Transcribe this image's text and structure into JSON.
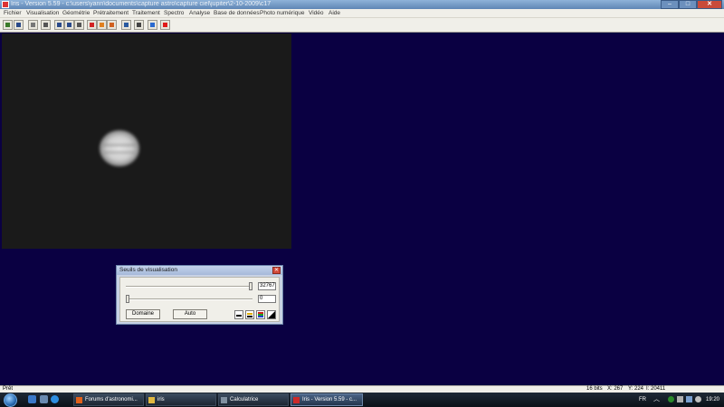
{
  "window": {
    "title": "Iris - Version 5.59 - c:\\users\\yann\\documents\\capture astro\\capture ciel\\jupiter\\2-10-2009\\c17",
    "minimize_glyph": "–",
    "maximize_glyph": "□",
    "close_glyph": "✕"
  },
  "menu": [
    "Fichier",
    "Visualisation",
    "Géométrie",
    "Prétraitement",
    "Traitement",
    "Spectro",
    "Analyse",
    "Base de données",
    "Photo numérique",
    "Vidéo",
    "Aide"
  ],
  "toolbar": {
    "icons": [
      "open-file-icon",
      "save-icon",
      "undo-icon",
      "list-icon",
      "grid-icon",
      "move-icon",
      "stats-icon",
      "red-circle-icon",
      "orange-square-icon",
      "histogram-icon",
      "palette-icon",
      "camera-icon",
      "arrows-icon",
      "record-icon"
    ],
    "colors": [
      "#3a7a2a",
      "#2a4a8a",
      "#777777",
      "#555555",
      "#2a4a8a",
      "#2a4a8a",
      "#555555",
      "#d22222",
      "#e08020",
      "#d06020",
      "#2a5aa0",
      "#444444",
      "#2a6ad0",
      "#e01a1a"
    ]
  },
  "dialog": {
    "title": "Seuils de visualisation",
    "close_glyph": "✕",
    "high_value": "32767",
    "low_value": "0",
    "domain_button": "Domaine",
    "auto_button": "Auto",
    "high_level": 1.0,
    "low_level": 0.0
  },
  "status": {
    "text": "Prêt",
    "bits": "16 bits",
    "x": "X: 267",
    "y": "Y: 224",
    "intensity": "I: 20411"
  },
  "taskbar": {
    "tasks": [
      {
        "label": "Forums d'astronomi...",
        "icon": "firefox-icon",
        "color": "#e0601a",
        "active": false
      },
      {
        "label": "iris",
        "icon": "folder-icon",
        "color": "#e0b840",
        "active": false
      },
      {
        "label": "Calculatrice",
        "icon": "calculator-icon",
        "color": "#8090a0",
        "active": false
      },
      {
        "label": "Iris - Version 5.59 - c...",
        "icon": "iris-app-icon",
        "color": "#cc2a2a",
        "active": true
      }
    ],
    "language": "FR",
    "clock": "19:20"
  },
  "colors": {
    "desktop_background": "#0a0042",
    "canvas_background": "#1a1a1a"
  }
}
